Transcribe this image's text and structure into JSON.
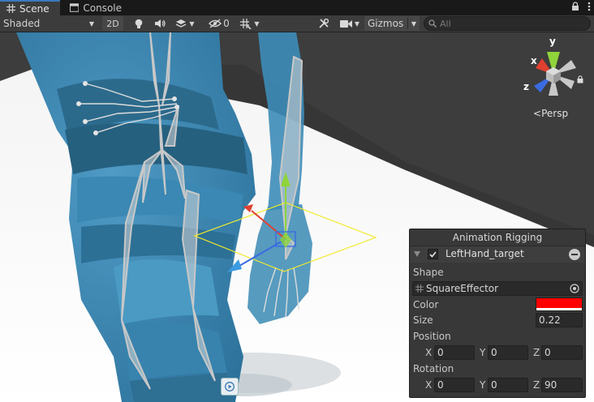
{
  "tabs": [
    {
      "label": "Scene",
      "active": true,
      "icon": "grid-icon"
    },
    {
      "label": "Console",
      "active": false,
      "icon": "console-icon"
    }
  ],
  "toolbar": {
    "draw_mode": "Shaded",
    "mode_2d": "2D",
    "hidden_count": "0",
    "gizmos": "Gizmos",
    "search_placeholder": "All"
  },
  "viewport": {
    "projection": "Persp",
    "axes": {
      "x": "x",
      "y": "y",
      "z": "z"
    },
    "axis_colors": {
      "x": "#e0402f",
      "y": "#8fd43a",
      "z": "#3b6be0"
    }
  },
  "panel": {
    "title": "Animation Rigging",
    "object_name": "LeftHand_target",
    "enabled": true,
    "shape_label": "Shape",
    "shape_value": "SquareEffector",
    "color_label": "Color",
    "color_value": "#ff0000",
    "size_label": "Size",
    "size_value": "0.22",
    "position_label": "Position",
    "position": {
      "x": "0",
      "y": "0",
      "z": "0"
    },
    "rotation_label": "Rotation",
    "rotation": {
      "x": "0",
      "y": "0",
      "z": "90"
    },
    "axis_labels": {
      "x": "X",
      "y": "Y",
      "z": "Z"
    }
  }
}
